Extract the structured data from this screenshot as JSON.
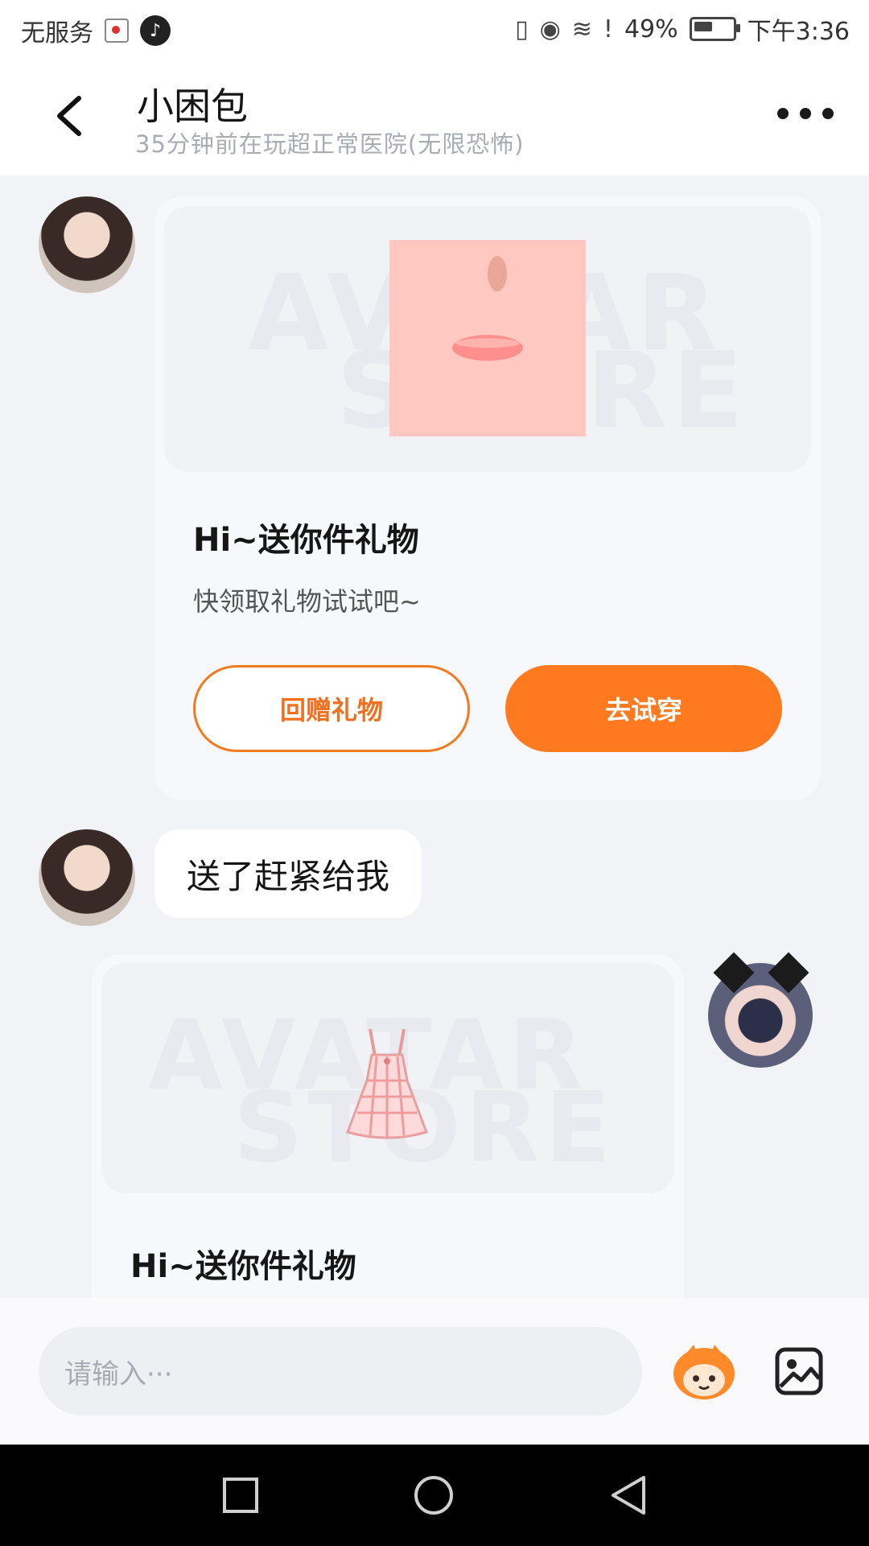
{
  "status_bar": {
    "carrier": "无服务",
    "battery": "49%",
    "time": "下午3:36"
  },
  "header": {
    "title": "小困包",
    "subtitle": "35分钟前在玩超正常医院(无限恐怖)"
  },
  "messages": [
    {
      "type": "gift",
      "watermark_line1": "AVATAR",
      "watermark_line2": "STORE",
      "title": "Hi~送你件礼物",
      "desc": "快领取礼物试试吧~",
      "btn_return": "回赠礼物",
      "btn_try": "去试穿"
    },
    {
      "type": "text",
      "text": "送了赶紧给我"
    },
    {
      "type": "gift",
      "watermark_line1": "AVATAR",
      "watermark_line2": "STORE",
      "title": "Hi~送你件礼物"
    }
  ],
  "input": {
    "placeholder": "请输入···"
  },
  "colors": {
    "accent": "#ff7a1f",
    "background": "#f2f3f7"
  }
}
